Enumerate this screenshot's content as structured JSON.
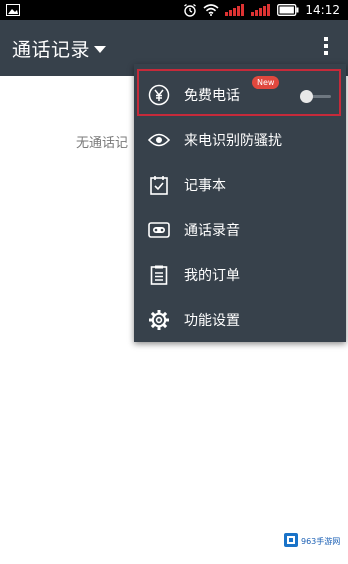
{
  "status_bar": {
    "time": "14:12",
    "icons": [
      "image-icon",
      "alarm-icon",
      "wifi-icon",
      "signal-icon",
      "signal-icon",
      "battery-icon"
    ]
  },
  "app_bar": {
    "title": "通话记录",
    "title_icon": "dropdown-triangle-icon",
    "menu_icon": "more-vert-icon"
  },
  "main": {
    "empty_text": "无通话记"
  },
  "menu": {
    "items": [
      {
        "label": "免费电话",
        "icon": "yuan-coin-icon",
        "badge": "New",
        "toggle_on": false
      },
      {
        "label": "来电识别防骚扰",
        "icon": "eye-icon"
      },
      {
        "label": "记事本",
        "icon": "notepad-check-icon"
      },
      {
        "label": "通话录音",
        "icon": "tape-recorder-icon"
      },
      {
        "label": "我的订单",
        "icon": "order-list-icon"
      },
      {
        "label": "功能设置",
        "icon": "gear-icon"
      }
    ]
  },
  "watermark": {
    "text": "963手游网"
  },
  "colors": {
    "app_bar": "#37414b",
    "menu_bg": "#37414b",
    "highlight": "#c62a3a",
    "badge": "#e0483e",
    "status_bar": "#000000"
  }
}
